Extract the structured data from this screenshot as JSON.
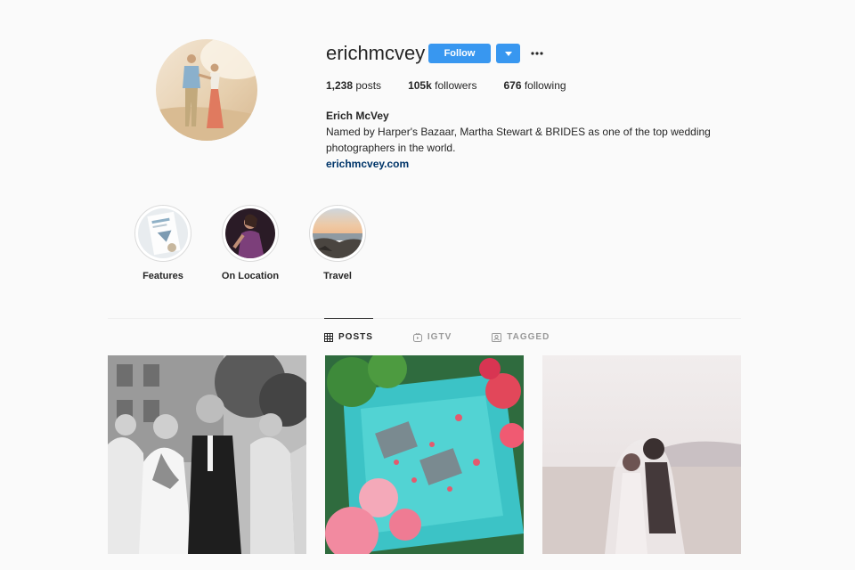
{
  "profile": {
    "username": "erichmcvey",
    "follow_label": "Follow",
    "stats": {
      "posts_count": "1,238",
      "posts_label": "posts",
      "followers_count": "105k",
      "followers_label": "followers",
      "following_count": "676",
      "following_label": "following"
    },
    "bio": {
      "name": "Erich McVey",
      "text": "Named by Harper's Bazaar, Martha Stewart & BRIDES as one of the top wedding photographers in the world.",
      "link": "erichmcvey.com"
    }
  },
  "highlights": [
    {
      "label": "Features"
    },
    {
      "label": "On Location"
    },
    {
      "label": "Travel"
    }
  ],
  "tabs": [
    {
      "label": "POSTS",
      "icon": "grid-icon",
      "active": true
    },
    {
      "label": "IGTV",
      "icon": "igtv-icon",
      "active": false
    },
    {
      "label": "TAGGED",
      "icon": "tagged-icon",
      "active": false
    }
  ],
  "colors": {
    "accent": "#3897f0",
    "link": "#003569",
    "background": "#fafafa",
    "text": "#262626",
    "muted": "#999999"
  }
}
